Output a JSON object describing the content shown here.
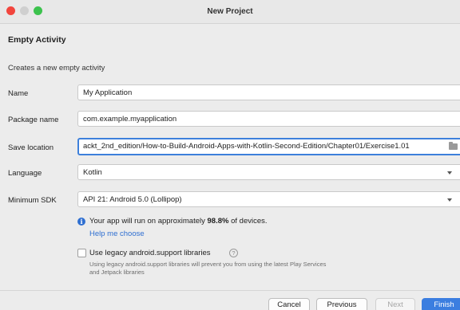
{
  "window": {
    "title": "New Project"
  },
  "heading": "Empty Activity",
  "subtitle": "Creates a new empty activity",
  "fields": {
    "name": {
      "label": "Name",
      "value": "My Application"
    },
    "package": {
      "label": "Package name",
      "value": "com.example.myapplication"
    },
    "save_location": {
      "label": "Save location",
      "value": "ackt_2nd_edition/How-to-Build-Android-Apps-with-Kotlin-Second-Edition/Chapter01/Exercise1.01"
    },
    "language": {
      "label": "Language",
      "value": "Kotlin"
    },
    "min_sdk": {
      "label": "Minimum SDK",
      "value": "API 21: Android 5.0 (Lollipop)"
    }
  },
  "info": {
    "prefix": "Your app will run on approximately ",
    "percent": "98.8%",
    "suffix": " of devices.",
    "help_link": "Help me choose"
  },
  "legacy": {
    "label": "Use legacy android.support libraries",
    "help_glyph": "?",
    "description": "Using legacy android.support libraries will prevent you from using the latest Play Services and Jetpack libraries"
  },
  "buttons": {
    "cancel": "Cancel",
    "previous": "Previous",
    "next": "Next",
    "finish": "Finish"
  },
  "icons": {
    "info": "i"
  },
  "colors": {
    "accent": "#3b7ee0",
    "link": "#2f6fd1",
    "close": "#f2453d",
    "zoom": "#3cc24d"
  }
}
